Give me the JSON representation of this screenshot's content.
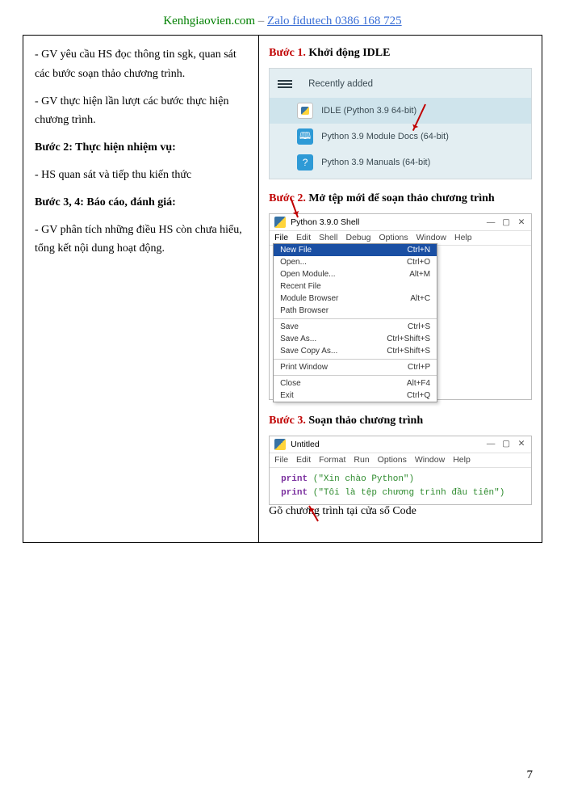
{
  "header": {
    "site": "Kenhgiaovien.com",
    "dash": " – ",
    "zalo": "Zalo fidutech 0386 168 725"
  },
  "left": {
    "p1": "- GV yêu cầu HS đọc thông tin sgk, quan sát các bước soạn thảo chương trình.",
    "p2": "- GV thực hiện lần lượt các bước thực hiện chương trình.",
    "h2": "Bước 2: Thực hiện nhiệm vụ:",
    "p3": "- HS quan sát và tiếp thu kiến thức",
    "h3": "Bước 3, 4: Báo cáo, đánh giá:",
    "p4": "- GV phân tích những điều HS còn chưa hiểu, tổng kết nội dung hoạt động."
  },
  "steps": {
    "s1": {
      "red": "Bước 1.",
      "rest": " Khởi động IDLE"
    },
    "s2": {
      "red": "Bước 2.",
      "rest": " Mở tệp mới để soạn thảo chương trình"
    },
    "s3": {
      "red": "Bước 3.",
      "rest": " Soạn thảo chương trình"
    }
  },
  "recent": {
    "label": "Recently added",
    "i1": "IDLE (Python 3.9 64-bit)",
    "i2": "Python 3.9 Module Docs (64-bit)",
    "i3": "Python 3.9 Manuals (64-bit)"
  },
  "shell": {
    "title": "Python 3.9.0 Shell",
    "menu": {
      "file": "File",
      "edit": "Edit",
      "shell": "Shell",
      "debug": "Debug",
      "options": "Options",
      "window": "Window",
      "help": "Help"
    },
    "items": [
      {
        "l": "New File",
        "r": "Ctrl+N",
        "sel": true
      },
      {
        "l": "Open...",
        "r": "Ctrl+O"
      },
      {
        "l": "Open Module...",
        "r": "Alt+M"
      },
      {
        "l": "Recent File",
        "r": ""
      },
      {
        "l": "Module Browser",
        "r": "Alt+C"
      },
      {
        "l": "Path Browser",
        "r": ""
      },
      {
        "hr": true
      },
      {
        "l": "Save",
        "r": "Ctrl+S"
      },
      {
        "l": "Save As...",
        "r": "Ctrl+Shift+S"
      },
      {
        "l": "Save Copy As...",
        "r": "Ctrl+Shift+S"
      },
      {
        "hr": true
      },
      {
        "l": "Print Window",
        "r": "Ctrl+P"
      },
      {
        "hr": true
      },
      {
        "l": "Close",
        "r": "Alt+F4"
      },
      {
        "l": "Exit",
        "r": "Ctrl+Q"
      }
    ]
  },
  "editor": {
    "title": "Untitled",
    "menu": {
      "file": "File",
      "edit": "Edit",
      "format": "Format",
      "run": "Run",
      "options": "Options",
      "window": "Window",
      "help": "Help"
    },
    "line1a": "print ",
    "line1b": "(\"Xin chào Python\")",
    "line2a": "print ",
    "line2b": "(\"Tôi là tệp chương trình đầu tiên\")",
    "caption": "Gõ chương trình tại cửa sổ Code"
  },
  "win_btns": {
    "min": "—",
    "max": "▢",
    "close": "✕"
  },
  "page_num": "7"
}
